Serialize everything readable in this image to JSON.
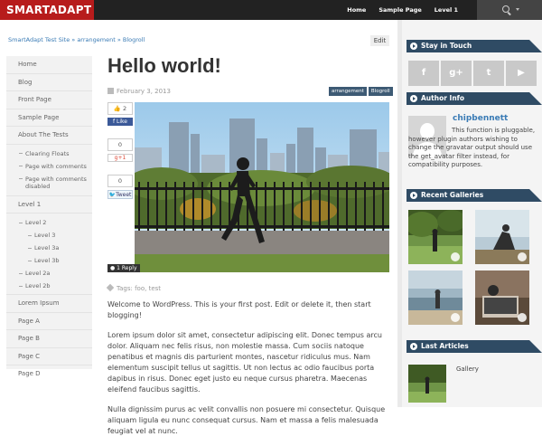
{
  "site": {
    "logo": "SMARTADAPT"
  },
  "topnav": {
    "items": [
      "Home",
      "Sample Page",
      "Level 1"
    ]
  },
  "breadcrumb": {
    "site": "SmartAdapt Test Site",
    "sep": " » ",
    "cat1": "arrangement",
    "cat2": "Blogroll"
  },
  "edit_label": "Edit",
  "leftnav": {
    "home": "Home",
    "blog": "Blog",
    "front_page": "Front Page",
    "sample_page": "Sample Page",
    "about": "About The Tests",
    "clearing": "Clearing Floats",
    "page_comments": "Page with comments",
    "page_comments_disabled": "Page with comments disabled",
    "level1": "Level 1",
    "level2": "Level 2",
    "level3": "Level 3",
    "level3a": "Level 3a",
    "level3b": "Level 3b",
    "level2a": "Level 2a",
    "level2b": "Level 2b",
    "lorem": "Lorem Ipsum",
    "page_a": "Page A",
    "page_b": "Page B",
    "page_c": "Page C",
    "page_d": "Page D"
  },
  "post": {
    "title": "Hello world!",
    "date": "February 3, 2013",
    "badges": [
      "arrangement",
      "Blogroll"
    ],
    "like_count": "2",
    "fb_like": "Like",
    "share_count_1": "0",
    "gplus": "+1",
    "share_count_2": "0",
    "tweet": "Tweet",
    "reply": "1 Reply",
    "tags_label": "Tags:",
    "tag1": "foo",
    "tag2": "test",
    "para1": "Welcome to WordPress. This is your first post. Edit or delete it, then start blogging!",
    "para2": "Lorem ipsum dolor sit amet, consectetur adipiscing elit. Donec tempus arcu dolor. Aliquam nec felis risus, non molestie massa. Cum sociis natoque penatibus et magnis dis parturient montes, nascetur ridiculus mus. Nam elementum suscipit tellus ut sagittis. Ut non lectus ac odio faucibus porta dapibus in risus. Donec eget justo eu neque cursus pharetra. Maecenas eleifend faucibus sagittis.",
    "para3": "Nulla dignissim purus ac velit convallis non posuere mi consectetur. Quisque aliquam ligula eu nunc consequat cursus. Nam et massa a felis malesuada feugiat vel at nunc."
  },
  "sidebar": {
    "stay_title": "Stay in Touch",
    "social": [
      "f",
      "g+",
      "t",
      "▶"
    ],
    "author_title": "Author Info",
    "author_name": "chipbennett",
    "author_text": "This function is pluggable, however plugin authors wishing to change the gravatar output should use the get_avatar filter instead, for compatibility purposes.",
    "galleries_title": "Recent Galleries",
    "last_title": "Last Articles",
    "last_item": "Gallery"
  },
  "colors": {
    "brand": "#b71c1c",
    "widget": "#2f4b64",
    "link": "#3a7bb5"
  }
}
